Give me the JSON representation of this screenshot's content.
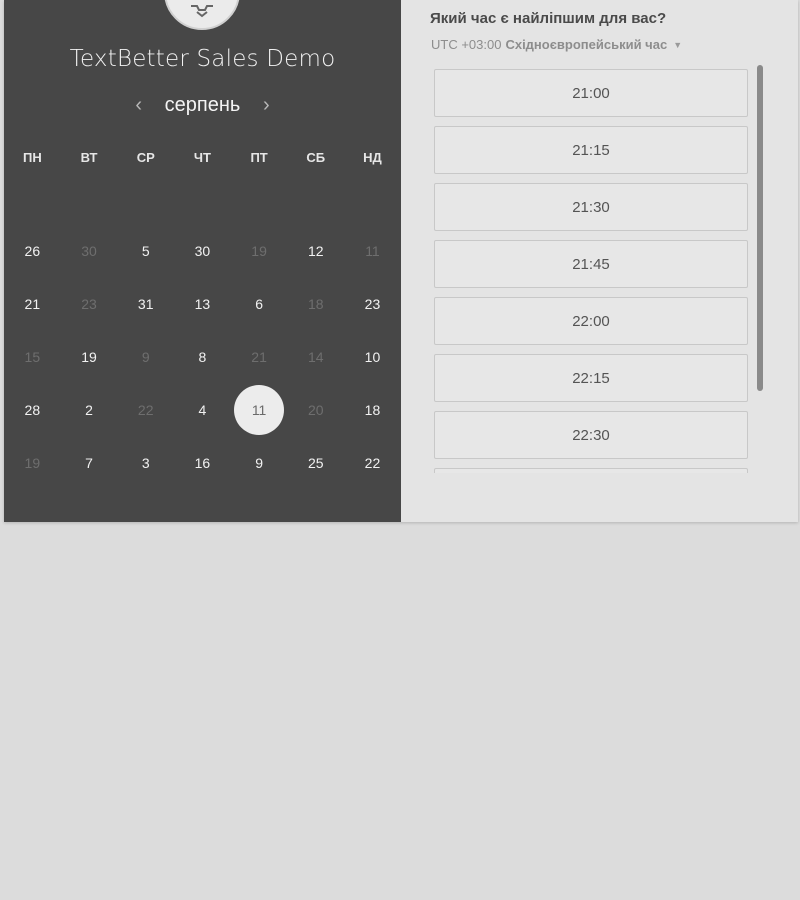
{
  "event": {
    "title": "TextBetter Sales Demo"
  },
  "calendar": {
    "month": "серпень",
    "prev_icon": "‹",
    "next_icon": "›",
    "weekdays": [
      "ПН",
      "ВТ",
      "СР",
      "ЧТ",
      "ПТ",
      "СБ",
      "НД"
    ],
    "weeks": [
      [
        {
          "d": "26",
          "muted": false
        },
        {
          "d": "30",
          "muted": true
        },
        {
          "d": "5",
          "muted": false
        },
        {
          "d": "30",
          "muted": false
        },
        {
          "d": "19",
          "muted": true
        },
        {
          "d": "12",
          "muted": false
        },
        {
          "d": "11",
          "muted": true
        }
      ],
      [
        {
          "d": "21",
          "muted": false
        },
        {
          "d": "23",
          "muted": true
        },
        {
          "d": "31",
          "muted": false
        },
        {
          "d": "13",
          "muted": false
        },
        {
          "d": "6",
          "muted": false
        },
        {
          "d": "18",
          "muted": true
        },
        {
          "d": "23",
          "muted": false
        }
      ],
      [
        {
          "d": "15",
          "muted": true
        },
        {
          "d": "19",
          "muted": false
        },
        {
          "d": "9",
          "muted": true
        },
        {
          "d": "8",
          "muted": false
        },
        {
          "d": "21",
          "muted": true
        },
        {
          "d": "14",
          "muted": true
        },
        {
          "d": "10",
          "muted": false
        }
      ],
      [
        {
          "d": "28",
          "muted": false
        },
        {
          "d": "2",
          "muted": false
        },
        {
          "d": "22",
          "muted": true
        },
        {
          "d": "4",
          "muted": false
        },
        {
          "d": "11",
          "muted": false,
          "selected": true
        },
        {
          "d": "20",
          "muted": true
        },
        {
          "d": "18",
          "muted": false
        }
      ],
      [
        {
          "d": "19",
          "muted": true
        },
        {
          "d": "7",
          "muted": false
        },
        {
          "d": "3",
          "muted": false
        },
        {
          "d": "16",
          "muted": false
        },
        {
          "d": "9",
          "muted": false
        },
        {
          "d": "25",
          "muted": false
        },
        {
          "d": "22",
          "muted": false
        }
      ]
    ]
  },
  "times": {
    "question": "Який час є найліпшим для вас?",
    "timezone_offset": "UTC +03:00",
    "timezone_name": "Східноєвропейський час",
    "caret": "▼",
    "slots": [
      "21:00",
      "21:15",
      "21:30",
      "21:45",
      "22:00",
      "22:15",
      "22:30",
      ""
    ]
  },
  "colors": {
    "left_panel": "#474747",
    "right_panel": "#e4e4e4",
    "page": "#dcdcdc"
  }
}
